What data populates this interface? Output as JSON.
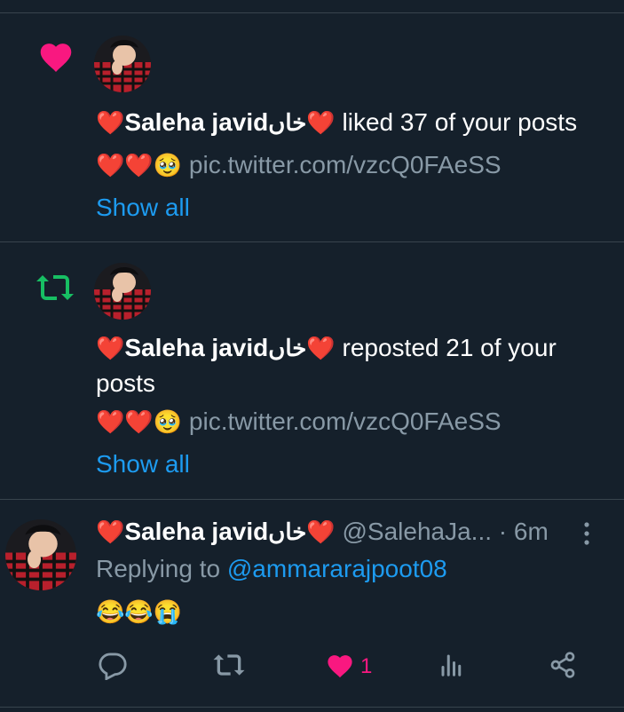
{
  "colors": {
    "background": "#15202b",
    "divider": "#38444d",
    "like_pink": "#f91880",
    "retweet_green": "#17bf63",
    "link_blue": "#1d9bf0",
    "muted": "#8899a6"
  },
  "notifications": [
    {
      "type": "like",
      "icon": "heart-icon",
      "name_prefix": "❤️",
      "name": "Saleha javid",
      "name_suffix": "خاں❤️",
      "action_text": " liked 37 of your posts",
      "preview_emoji": "❤️❤️🥹",
      "preview_link": " pic.twitter.com/vzcQ0FAeSS",
      "show_all": "Show all"
    },
    {
      "type": "repost",
      "icon": "retweet-icon",
      "name_prefix": "❤️",
      "name": "Saleha javid",
      "name_suffix": "خاں❤️",
      "action_text": " reposted 21 of your",
      "action_text_cont": "posts",
      "preview_emoji": "❤️❤️🥹",
      "preview_link": " pic.twitter.com/vzcQ0FAeSS",
      "show_all": "Show all"
    }
  ],
  "reply": {
    "name_prefix": "❤️",
    "name": "Saleha javid",
    "name_suffix": "خاں❤️",
    "handle": " @SalehaJa...",
    "time": " · 6m",
    "replying_label": "Replying to ",
    "replying_to": "@ammararajpoot08",
    "body": "😂😂😭",
    "actions": {
      "reply_icon": "reply-icon",
      "retweet_icon": "retweet-icon",
      "like_icon": "heart-icon",
      "like_count": "1",
      "views_icon": "analytics-icon",
      "share_icon": "share-icon"
    }
  }
}
